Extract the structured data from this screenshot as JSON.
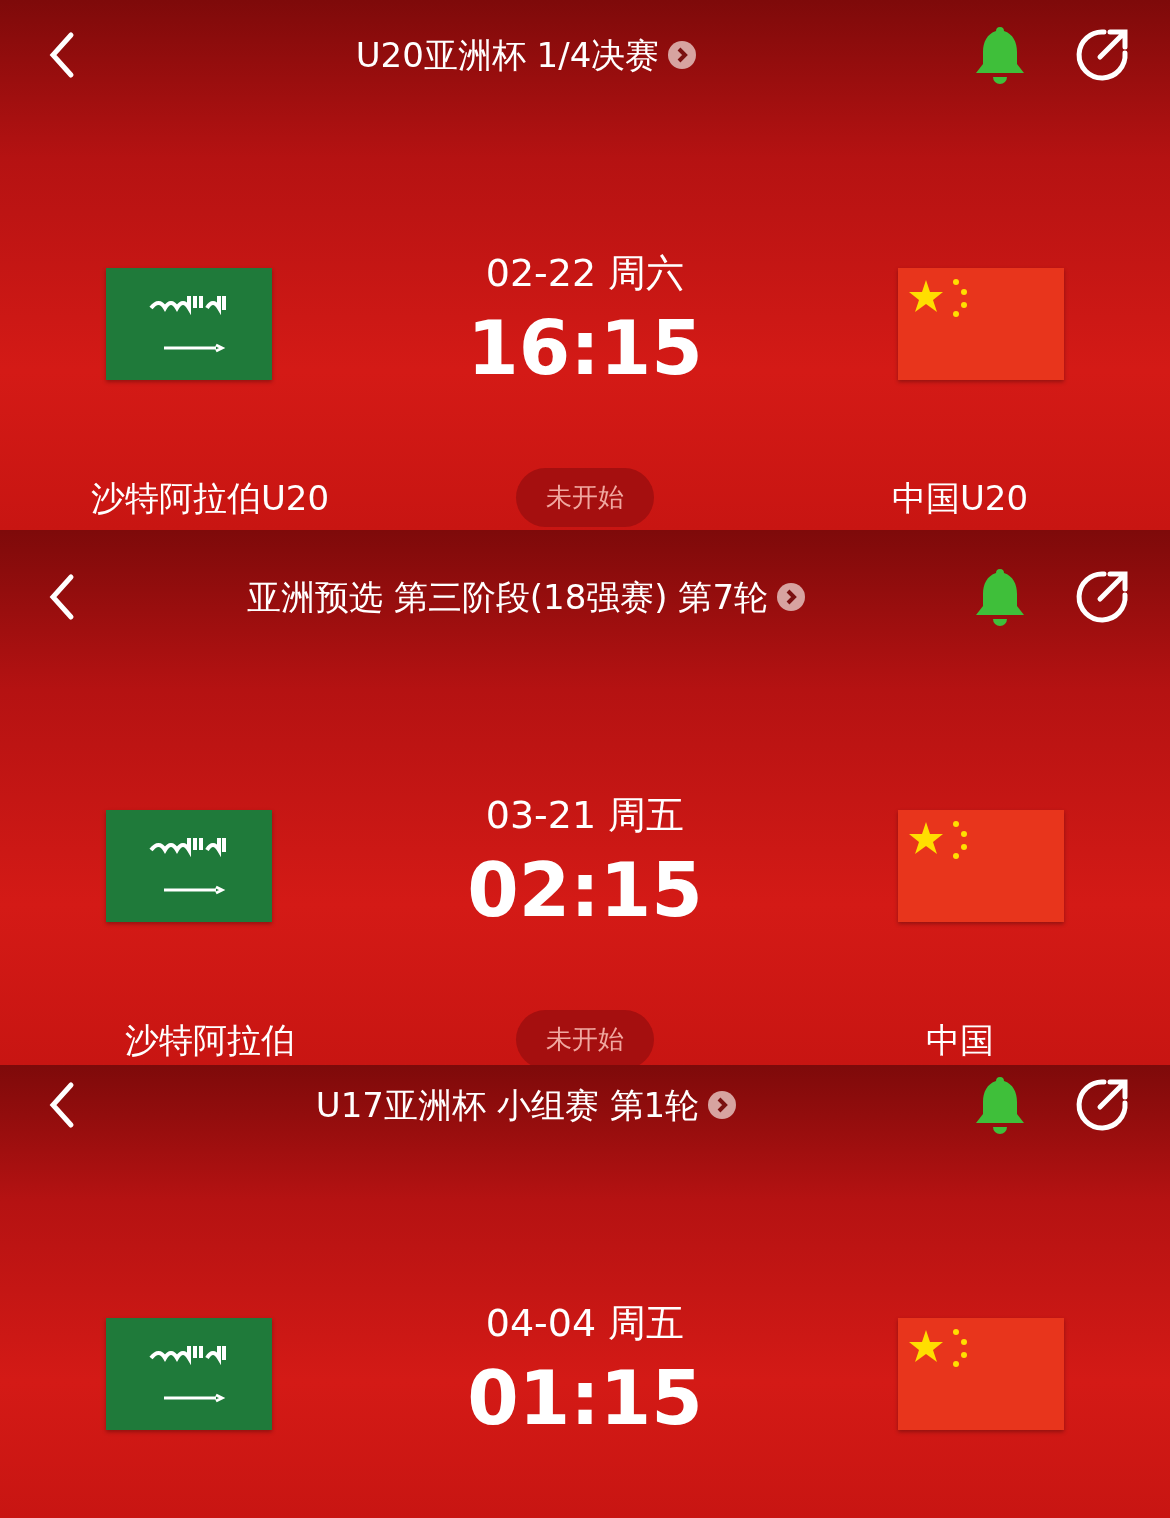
{
  "panels": [
    {
      "title": "U20亚洲杯 1/4决赛",
      "reminder_on": true,
      "date": "02-22 周六",
      "time": "16:15",
      "home": "沙特阿拉伯U20",
      "away": "中国U20",
      "status": "未开始"
    },
    {
      "title": "亚洲预选 第三阶段(18强赛) 第7轮",
      "reminder_on": true,
      "date": "03-21 周五",
      "time": "02:15",
      "home": "沙特阿拉伯",
      "away": "中国",
      "status": "未开始"
    },
    {
      "title": "U17亚洲杯 小组赛 第1轮",
      "reminder_on": true,
      "date": "04-04 周五",
      "time": "01:15"
    }
  ]
}
